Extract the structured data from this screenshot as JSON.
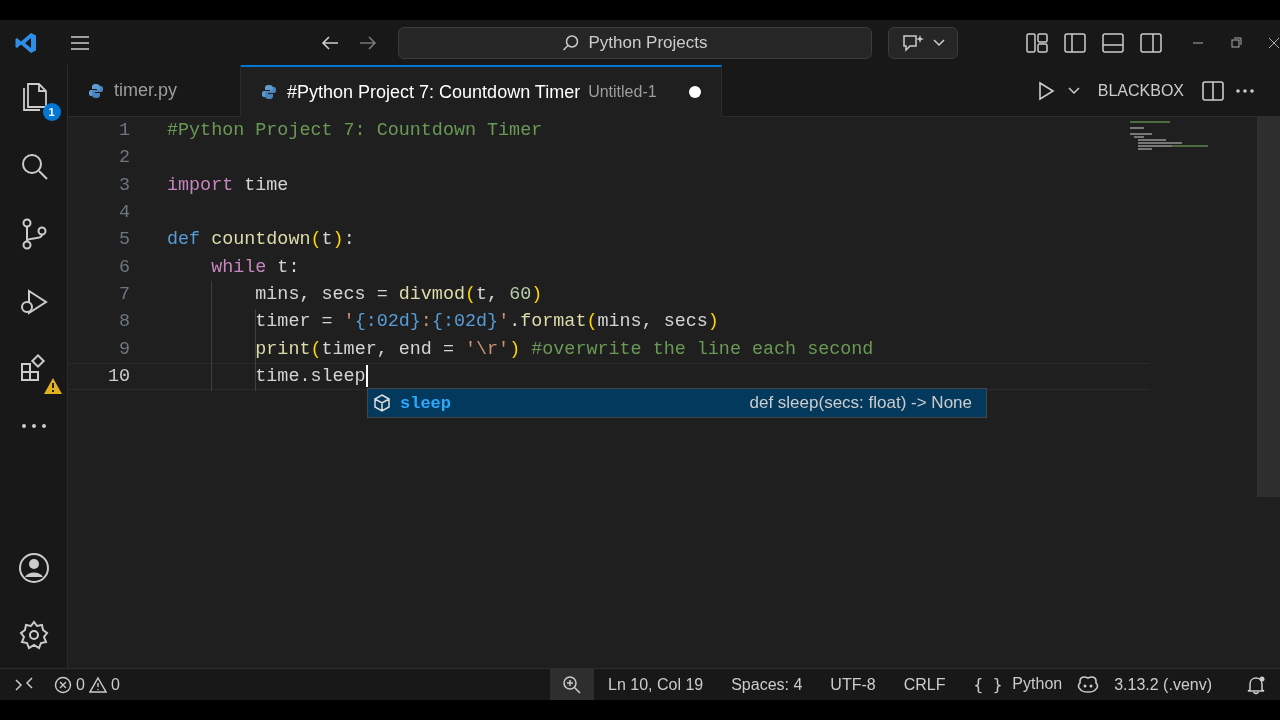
{
  "title_bar": {
    "search": "Python Projects"
  },
  "activity_bar": {
    "explorer_badge": "1"
  },
  "tabs": [
    {
      "label": "timer.py",
      "selected": false,
      "dirty": false
    },
    {
      "label": "#Python Project 7: Countdown Timer",
      "note": "Untitled-1",
      "selected": true,
      "dirty": true
    }
  ],
  "editor_actions": {
    "label": "BLACKBOX"
  },
  "lines": [
    {
      "number": "1",
      "current": false,
      "tokens": [
        {
          "kind": "comment",
          "text": "#Python Project 7: Countdown Timer"
        }
      ]
    },
    {
      "number": "2",
      "current": false
    },
    {
      "number": "3",
      "current": false,
      "tokens": [
        {
          "kind": "keyword",
          "text": "import"
        },
        {
          "kind": "plain",
          "text": " time"
        }
      ]
    },
    {
      "number": "4",
      "current": false
    },
    {
      "number": "5",
      "current": false,
      "tokens": [
        {
          "kind": "storage",
          "text": "def"
        },
        {
          "kind": "function",
          "text": " countdown"
        },
        {
          "kind": "bracket",
          "text": "("
        },
        {
          "kind": "plain",
          "text": "t"
        },
        {
          "kind": "bracket",
          "text": ")"
        },
        {
          "kind": "plain",
          "text": ":"
        }
      ]
    },
    {
      "number": "6",
      "current": false,
      "tokens": [
        {
          "kind": "keyword",
          "text": "    while"
        },
        {
          "kind": "plain",
          "text": " t:"
        }
      ]
    },
    {
      "number": "7",
      "current": false,
      "tokens": [
        {
          "kind": "plain",
          "text": "        mins, secs = "
        },
        {
          "kind": "function",
          "text": "divmod"
        },
        {
          "kind": "bracket",
          "text": "("
        },
        {
          "kind": "plain",
          "text": "t, "
        },
        {
          "kind": "number",
          "text": "60"
        },
        {
          "kind": "bracket",
          "text": ")"
        }
      ]
    },
    {
      "number": "8",
      "current": false,
      "tokens": [
        {
          "kind": "plain",
          "text": "        timer = "
        },
        {
          "kind": "string",
          "text": "'"
        },
        {
          "kind": "storage",
          "text": "{:02d}"
        },
        {
          "kind": "string",
          "text": ":"
        },
        {
          "kind": "storage",
          "text": "{:02d}"
        },
        {
          "kind": "string",
          "text": "'"
        },
        {
          "kind": "plain",
          "text": "."
        },
        {
          "kind": "function",
          "text": "format"
        },
        {
          "kind": "bracket",
          "text": "("
        },
        {
          "kind": "plain",
          "text": "mins, secs"
        },
        {
          "kind": "bracket",
          "text": ")"
        }
      ]
    },
    {
      "number": "9",
      "current": false,
      "tokens": [
        {
          "kind": "function",
          "text": "        print"
        },
        {
          "kind": "bracket",
          "text": "("
        },
        {
          "kind": "plain",
          "text": "timer, end = "
        },
        {
          "kind": "string",
          "text": "'\\r'"
        },
        {
          "kind": "bracket",
          "text": ")"
        },
        {
          "kind": "comment",
          "text": " #overwrite the line each second"
        }
      ]
    },
    {
      "number": "10",
      "current": true,
      "tokens": [
        {
          "kind": "plain",
          "text": "        time.sleep"
        }
      ]
    }
  ],
  "suggest": {
    "label": "sleep",
    "detail": "def sleep(secs: float) -> None"
  },
  "status_bar": {
    "errors": "0",
    "warnings": "0",
    "items": [
      "Ln 10, Col 19",
      "Spaces: 4",
      "UTF-8",
      "CRLF"
    ],
    "language_icon": "{ }",
    "language": "Python",
    "interpreter": "3.13.2 (.venv)"
  }
}
